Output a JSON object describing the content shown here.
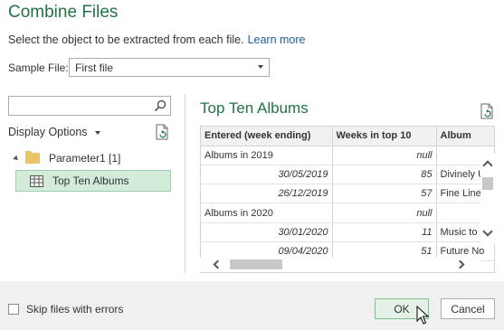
{
  "dialog": {
    "title": "Combine Files",
    "instruction": "Select the object to be extracted from each file.",
    "learn_more": "Learn more"
  },
  "sample_file": {
    "label": "Sample File:",
    "value": "First file"
  },
  "navigator": {
    "search_placeholder": "",
    "display_options": "Display Options",
    "folder_label": "Parameter1 [1]",
    "selected_item": "Top Ten Albums"
  },
  "preview": {
    "title": "Top Ten Albums",
    "columns": [
      "Entered (week ending)",
      "Weeks in top 10",
      "Album"
    ],
    "rows": [
      {
        "c1": "Albums in 2019",
        "c2": "null",
        "c3": "",
        "group": true
      },
      {
        "c1": "30/05/2019",
        "c2": "85",
        "c3": "Divinely U",
        "group": false
      },
      {
        "c1": "26/12/2019",
        "c2": "57",
        "c3": "Fine Line",
        "group": false
      },
      {
        "c1": "Albums in 2020",
        "c2": "null",
        "c3": "",
        "group": true
      },
      {
        "c1": "30/01/2020",
        "c2": "11",
        "c3": "Music to B",
        "group": false
      },
      {
        "c1": "09/04/2020",
        "c2": "51",
        "c3": "Future No",
        "group": false
      }
    ]
  },
  "footer": {
    "skip_errors": "Skip files with errors",
    "ok": "OK",
    "cancel": "Cancel"
  },
  "colors": {
    "accent": "#217346",
    "link": "#1e5fa8",
    "selected_bg": "#d3ecda"
  }
}
